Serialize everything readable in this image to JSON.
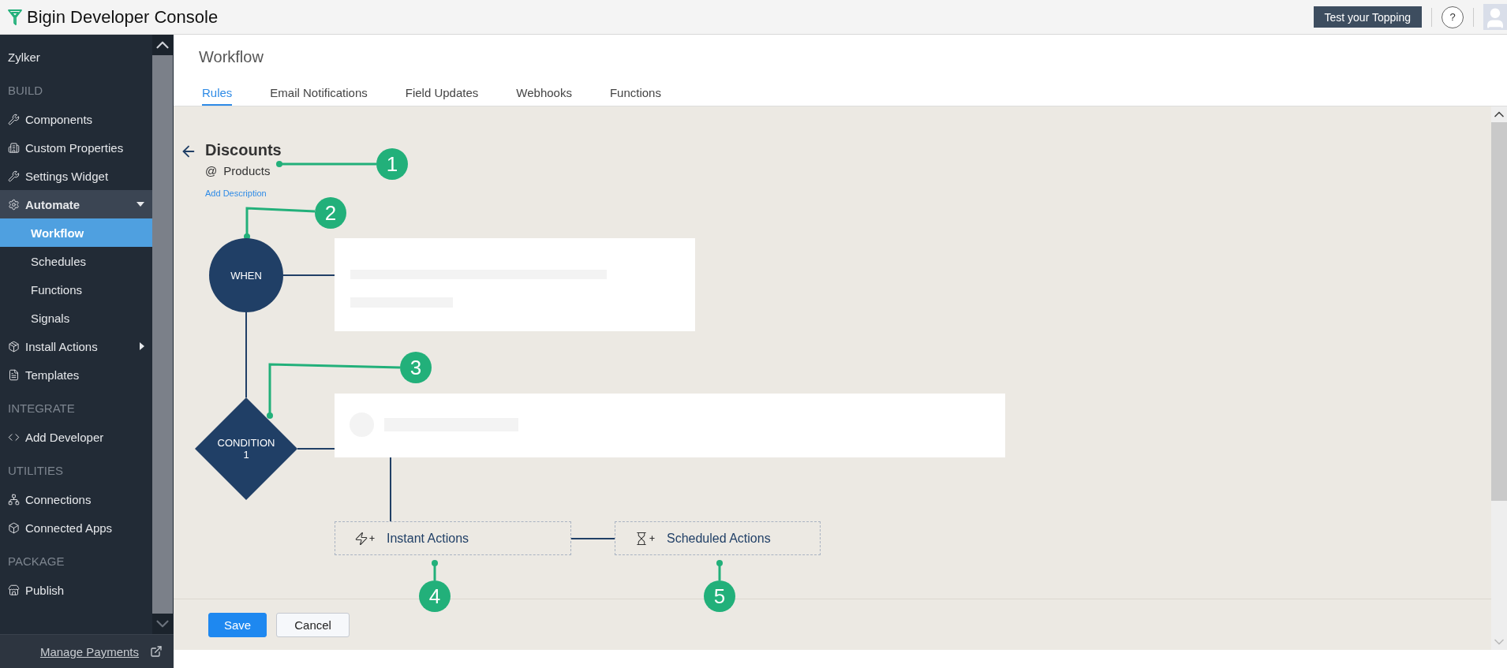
{
  "app": {
    "title": "Bigin Developer Console"
  },
  "header_actions": {
    "test_button": "Test your Topping",
    "help": "?"
  },
  "sidebar": {
    "items": [
      {
        "kind": "org",
        "label": "Zylker"
      },
      {
        "kind": "heading",
        "label": "BUILD"
      },
      {
        "kind": "item",
        "label": "Components",
        "selected": false
      },
      {
        "kind": "item",
        "label": "Custom Properties",
        "selected": false
      },
      {
        "kind": "item",
        "label": "Settings Widget",
        "selected": false
      },
      {
        "kind": "group",
        "label": "Automate",
        "expanded": true,
        "selected": false,
        "children": [
          {
            "label": "Workflow",
            "selected": true
          },
          {
            "label": "Schedules",
            "selected": false
          },
          {
            "label": "Functions",
            "selected": false
          },
          {
            "label": "Signals",
            "selected": false
          }
        ]
      },
      {
        "kind": "group",
        "label": "Install Actions",
        "expanded": false,
        "selected": false
      },
      {
        "kind": "item",
        "label": "Templates",
        "selected": false
      },
      {
        "kind": "heading",
        "label": "INTEGRATE"
      },
      {
        "kind": "item",
        "label": "Add Developer",
        "selected": false
      },
      {
        "kind": "heading",
        "label": "UTILITIES"
      },
      {
        "kind": "item",
        "label": "Connections",
        "selected": false
      },
      {
        "kind": "item",
        "label": "Connected Apps",
        "selected": false
      },
      {
        "kind": "heading",
        "label": "PACKAGE"
      },
      {
        "kind": "item",
        "label": "Publish",
        "selected": false
      }
    ],
    "footer_link": "Manage Payments"
  },
  "page": {
    "title": "Workflow",
    "tabs": [
      {
        "label": "Rules",
        "selected": true
      },
      {
        "label": "Email Notifications",
        "selected": false
      },
      {
        "label": "Field Updates",
        "selected": false
      },
      {
        "label": "Webhooks",
        "selected": false
      },
      {
        "label": "Functions",
        "selected": false
      }
    ]
  },
  "rule": {
    "title": "Discounts",
    "at": "@",
    "module": "Products",
    "add_description": "Add Description"
  },
  "diagram": {
    "when": "WHEN",
    "condition": {
      "label": "CONDITION",
      "number": "1"
    },
    "actions": [
      {
        "kind": "instant",
        "label": "Instant Actions"
      },
      {
        "kind": "scheduled",
        "label": "Scheduled Actions"
      }
    ],
    "callouts": [
      "1",
      "2",
      "3",
      "4",
      "5"
    ]
  },
  "buttons": [
    {
      "kind": "primary",
      "label": "Save"
    },
    {
      "kind": "secondary",
      "label": "Cancel"
    }
  ]
}
